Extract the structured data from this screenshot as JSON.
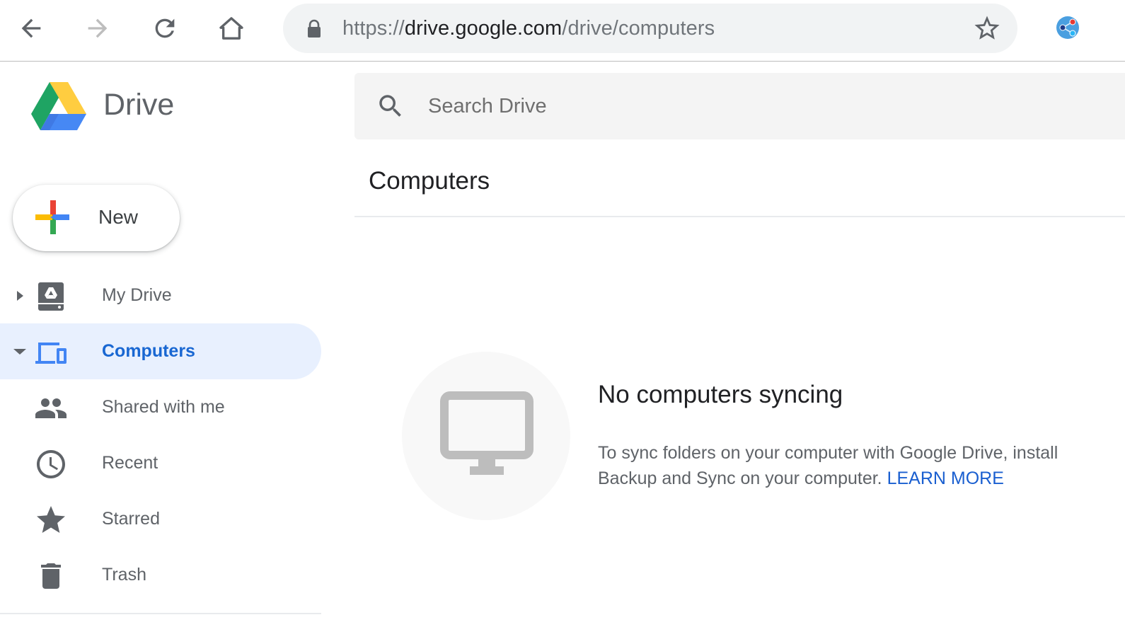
{
  "browser": {
    "url_scheme": "https://",
    "url_host": "drive.google.com",
    "url_path": "/drive/computers",
    "icons": {
      "back": "arrow-left-icon",
      "forward": "arrow-right-icon",
      "reload": "reload-icon",
      "home": "home-icon",
      "lock": "lock-icon",
      "bookmark": "star-outline-icon",
      "extension": "share-extension-icon"
    }
  },
  "app": {
    "product_name": "Drive",
    "new_button_label": "New"
  },
  "sidebar": {
    "items": [
      {
        "label": "My Drive",
        "icon": "my-drive-icon",
        "caret": "right",
        "active": false
      },
      {
        "label": "Computers",
        "icon": "computers-icon",
        "caret": "down",
        "active": true
      },
      {
        "label": "Shared with me",
        "icon": "people-icon",
        "active": false
      },
      {
        "label": "Recent",
        "icon": "clock-icon",
        "active": false
      },
      {
        "label": "Starred",
        "icon": "star-icon",
        "active": false
      },
      {
        "label": "Trash",
        "icon": "trash-icon",
        "active": false
      }
    ]
  },
  "search": {
    "placeholder": "Search Drive",
    "value": ""
  },
  "main": {
    "title": "Computers",
    "empty_state": {
      "icon": "desktop-monitor-icon",
      "heading": "No computers syncing",
      "description": "To sync folders on your computer with Google Drive, install Backup and Sync on your computer.",
      "link_label": "LEARN MORE"
    }
  },
  "colors": {
    "accent_blue": "#1967d2",
    "active_bg": "#e8f0fe",
    "icon_gray": "#5f6368",
    "link_blue": "#1a5fd0"
  }
}
